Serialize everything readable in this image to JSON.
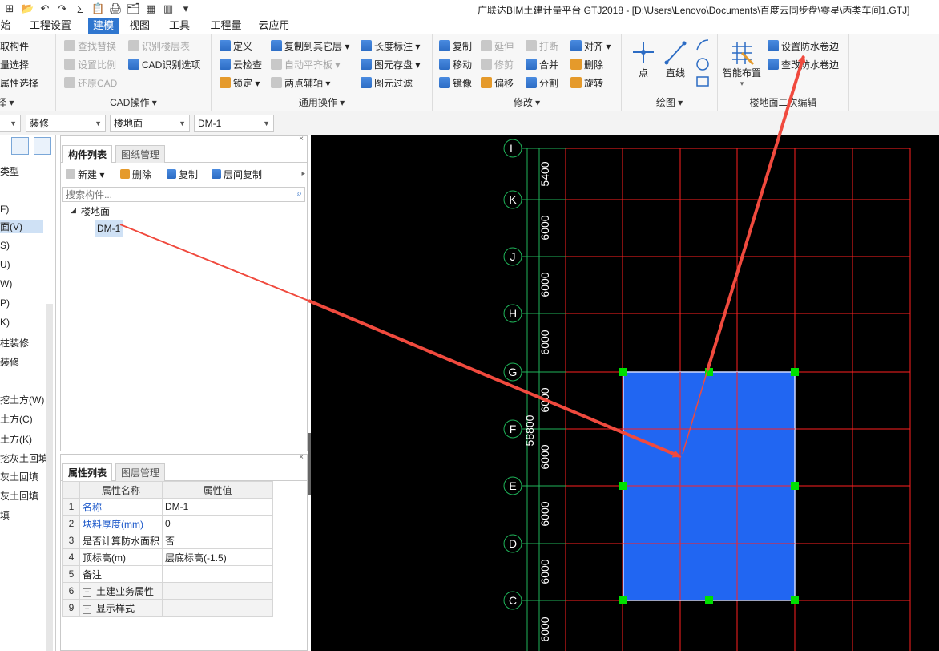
{
  "window": {
    "title": "广联达BIM土建计量平台 GTJ2018 - [D:\\Users\\Lenovo\\Documents\\百度云同步盘\\零星\\丙类车间1.GTJ]",
    "quick_access": [
      "⊞",
      "📂",
      "↶",
      "↷",
      "Σ",
      "📋",
      "🖨",
      "🗂",
      "▦",
      "▥",
      "▾"
    ]
  },
  "menu": {
    "items": [
      "始",
      "工程设置",
      "建模",
      "视图",
      "工具",
      "工程量",
      "云应用"
    ],
    "active": "建模"
  },
  "ribbon": {
    "select_group": {
      "items": [
        "拾取构件",
        "批量选择",
        "按属性选择"
      ],
      "title": "择 ▾"
    },
    "cad_group": {
      "items": [
        "查找替换",
        "识别楼层表",
        "设置比例",
        "CAD识别选项",
        "还原CAD"
      ],
      "title": "CAD操作 ▾"
    },
    "common_group": {
      "items": [
        "定义",
        "复制到其它层 ▾",
        "长度标注 ▾",
        "云检查",
        "自动平齐板 ▾",
        "图元存盘 ▾",
        "锁定 ▾",
        "两点辅轴 ▾",
        "图元过滤"
      ],
      "title": "通用操作 ▾"
    },
    "modify_group": {
      "items": [
        "复制",
        "延伸",
        "打断",
        "对齐 ▾",
        "移动",
        "修剪",
        "合并",
        "删除",
        "镜像",
        "偏移",
        "分割",
        "旋转"
      ],
      "title": "修改 ▾"
    },
    "draw_group": {
      "items": [
        "点",
        "直线"
      ],
      "title": "绘图 ▾"
    },
    "floor_group": {
      "items": [
        "智能布置",
        "设置防水卷边",
        "查改防水卷边"
      ],
      "title": "楼地面二次编辑"
    }
  },
  "toolbar2": {
    "selects": [
      "",
      "装修",
      "楼地面",
      "DM-1"
    ]
  },
  "left_nav": {
    "top_label": "类型",
    "items": [
      "F)",
      "面(V)",
      "S)",
      "U)",
      "W)",
      "P)",
      "K)",
      "柱装修",
      "装修",
      "",
      "挖土方(W)",
      "土方(C)",
      "土方(K)",
      "挖灰土回填",
      "灰土回填",
      "灰土回填",
      "填"
    ],
    "selected_index": 1
  },
  "component_panel": {
    "tabs": [
      "构件列表",
      "图纸管理"
    ],
    "actions": [
      "新建 ▾",
      "删除",
      "复制",
      "层间复制"
    ],
    "search_placeholder": "搜索构件...",
    "tree_root": "楼地面",
    "tree_item": "DM-1"
  },
  "property_panel": {
    "tabs": [
      "属性列表",
      "图层管理"
    ],
    "headers": [
      "属性名称",
      "属性值"
    ],
    "rows": [
      {
        "num": "1",
        "name": "名称",
        "value": "DM-1",
        "blue": true
      },
      {
        "num": "2",
        "name": "块料厚度(mm)",
        "value": "0",
        "blue": true
      },
      {
        "num": "3",
        "name": "是否计算防水面积",
        "value": "否",
        "blue": false
      },
      {
        "num": "4",
        "name": "顶标高(m)",
        "value": "层底标高(-1.5)",
        "blue": false
      },
      {
        "num": "5",
        "name": "备注",
        "value": "",
        "blue": false
      },
      {
        "num": "6",
        "name": "土建业务属性",
        "value": "",
        "blue": false,
        "expand": true
      },
      {
        "num": "9",
        "name": "显示样式",
        "value": "",
        "blue": false,
        "expand": true
      }
    ]
  },
  "canvas": {
    "axis_labels": [
      "L",
      "K",
      "J",
      "H",
      "G",
      "F",
      "E",
      "D",
      "C"
    ],
    "dimensions": [
      "5400",
      "6000",
      "6000",
      "6000",
      "6000",
      "6000",
      "6000",
      "6000",
      "6000"
    ],
    "total_dimension": "58800",
    "colors": {
      "grid": "#ff2020",
      "room": "#2166f2",
      "grip": "#00e000",
      "arrow": "#f04a3e"
    }
  }
}
